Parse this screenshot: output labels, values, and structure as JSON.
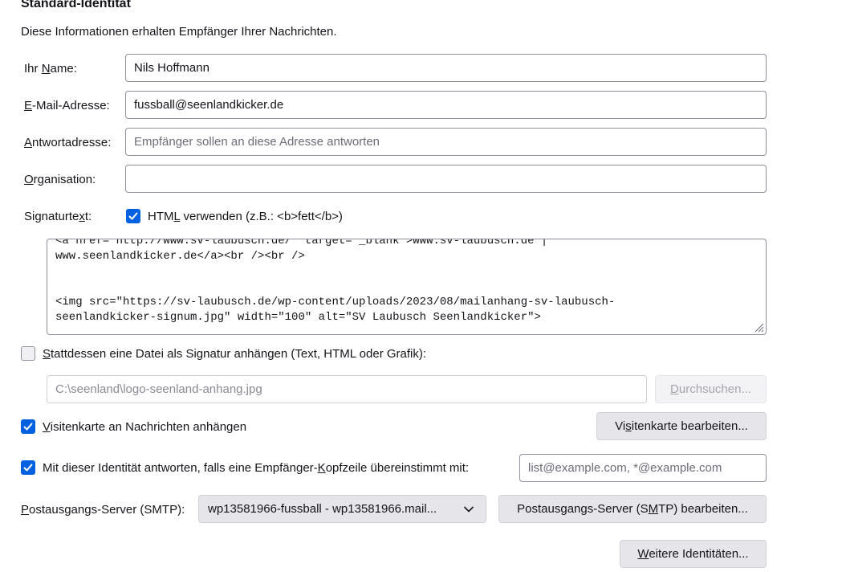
{
  "section": {
    "title": "Standard-Identität",
    "description": "Diese Informationen erhalten Empfänger Ihrer Nachrichten."
  },
  "fields": {
    "name": {
      "label_pre": "Ihr ",
      "label_key": "N",
      "label_post": "ame:",
      "value": "Nils Hoffmann"
    },
    "email": {
      "label_pre": "",
      "label_key": "E",
      "label_post": "-Mail-Adresse:",
      "value": "fussball@seenlandkicker.de"
    },
    "reply": {
      "label_pre": "",
      "label_key": "A",
      "label_post": "ntwortadresse:",
      "placeholder": "Empfänger sollen an diese Adresse antworten"
    },
    "org": {
      "label_pre": "",
      "label_key": "O",
      "label_post": "rganisation:",
      "value": ""
    }
  },
  "signature": {
    "label_pre": "Signaturte",
    "label_key": "x",
    "label_post": "t:",
    "html_checkbox_pre": "HTM",
    "html_checkbox_key": "L",
    "html_checkbox_post": " verwenden (z.B.: <b>fett</b>)",
    "html_checked": true,
    "text": "<a href=\"http://www.sv-laubusch.de/\" target=\"_blank\">www.sv-laubusch.de |\nwww.seenlandkicker.de</a><br /><br />\n\n\n<img src=\"https://sv-laubusch.de/wp-content/uploads/2023/08/mailanhang-sv-laubusch-\nseenlandkicker-signum.jpg\" width=\"100\" alt=\"SV Laubusch Seenlandkicker\">"
  },
  "file_signature": {
    "label_key": "S",
    "label_post": "tattdessen eine Datei als Signatur anhängen (Text, HTML oder Grafik):",
    "checked": false,
    "path": "C:\\seenland\\logo-seenland-anhang.jpg",
    "browse_pre": "",
    "browse_key": "D",
    "browse_post": "urchsuchen..."
  },
  "vcard": {
    "label_key": "V",
    "label_post": "isitenkarte an Nachrichten anhängen",
    "checked": true,
    "edit_pre": "Vi",
    "edit_key": "s",
    "edit_post": "itenkarte bearbeiten..."
  },
  "reply_match": {
    "label_pre": "Mit dieser Identität antworten, falls eine Empfänger-",
    "label_key": "K",
    "label_post": "opfzeile übereinstimmt mit:",
    "checked": true,
    "placeholder": "list@example.com, *@example.com"
  },
  "smtp": {
    "label_key": "P",
    "label_post": "ostausgangs-Server (SMTP):",
    "selected": "wp13581966-fussball - wp13581966.mail...",
    "edit_pre": "Postausgangs-Server (S",
    "edit_key": "M",
    "edit_post": "TP) bearbeiten..."
  },
  "more": {
    "label_pre": "",
    "label_key": "W",
    "label_post": "eitere Identitäten..."
  },
  "colors": {
    "accent": "#0061e0",
    "button": "#e6e6ea",
    "border": "#8f8f9d"
  }
}
